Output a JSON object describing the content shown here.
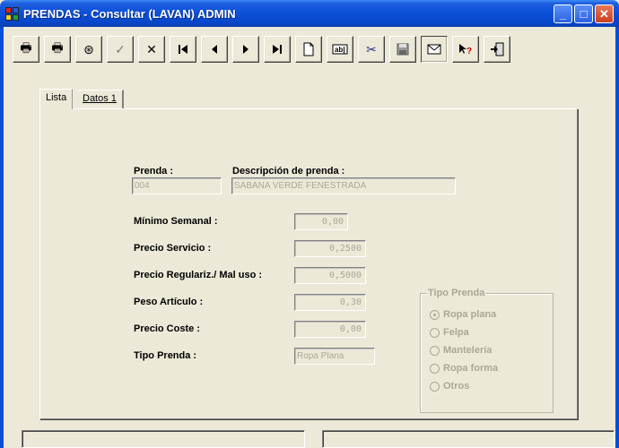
{
  "window": {
    "title": "PRENDAS - Consultar (LAVAN) ADMIN",
    "min_glyph": "_",
    "max_glyph": "□",
    "close_glyph": "✕"
  },
  "toolbar": [
    {
      "name": "print-icon",
      "glyph": "🖶"
    },
    {
      "name": "print-preview-icon",
      "glyph": "🖶"
    },
    {
      "name": "binoculars-icon",
      "glyph": "⊛"
    },
    {
      "name": "check-icon",
      "glyph": "✓"
    },
    {
      "name": "cancel-icon",
      "glyph": "✕"
    },
    {
      "name": "first-record-icon",
      "glyph": "⏮"
    },
    {
      "name": "previous-record-icon",
      "glyph": "◀"
    },
    {
      "name": "next-record-icon",
      "glyph": "▶"
    },
    {
      "name": "last-record-icon",
      "glyph": "⏭"
    },
    {
      "name": "new-document-icon",
      "glyph": "🗋"
    },
    {
      "name": "edit-field-icon",
      "glyph": "ab|"
    },
    {
      "name": "scissors-icon",
      "glyph": "✂"
    },
    {
      "name": "save-icon",
      "glyph": "💾"
    },
    {
      "name": "mail-icon",
      "glyph": "✉"
    },
    {
      "name": "help-icon",
      "glyph": "?"
    },
    {
      "name": "exit-icon",
      "glyph": "⇥"
    }
  ],
  "tabs": [
    {
      "label": "Lista",
      "active": true
    },
    {
      "label": "Datos 1",
      "active": false
    }
  ],
  "form": {
    "prenda_label": "Prenda :",
    "prenda_value": "004",
    "descripcion_label": "Descripción de prenda :",
    "descripcion_value": "SABANA VERDE FENESTRADA",
    "minimo_label": "Mínimo Semanal :",
    "minimo_value": "0,00",
    "precio_servicio_label": "Precio Servicio :",
    "precio_servicio_value": "0,2500",
    "precio_regulariz_label": "Precio Regulariz./ Mal uso :",
    "precio_regulariz_value": "0,5000",
    "peso_label": "Peso Artículo :",
    "peso_value": "0,30",
    "precio_coste_label": "Precio Coste :",
    "precio_coste_value": "0,00",
    "tipo_prenda_label": "Tipo Prenda :",
    "tipo_prenda_value": "Ropa Plana"
  },
  "tipo_group": {
    "title": "Tipo Prenda",
    "options": [
      {
        "label": "Ropa plana",
        "selected": true
      },
      {
        "label": "Felpa",
        "selected": false
      },
      {
        "label": "Mantelería",
        "selected": false
      },
      {
        "label": "Ropa forma",
        "selected": false
      },
      {
        "label": "Otros",
        "selected": false
      }
    ]
  }
}
